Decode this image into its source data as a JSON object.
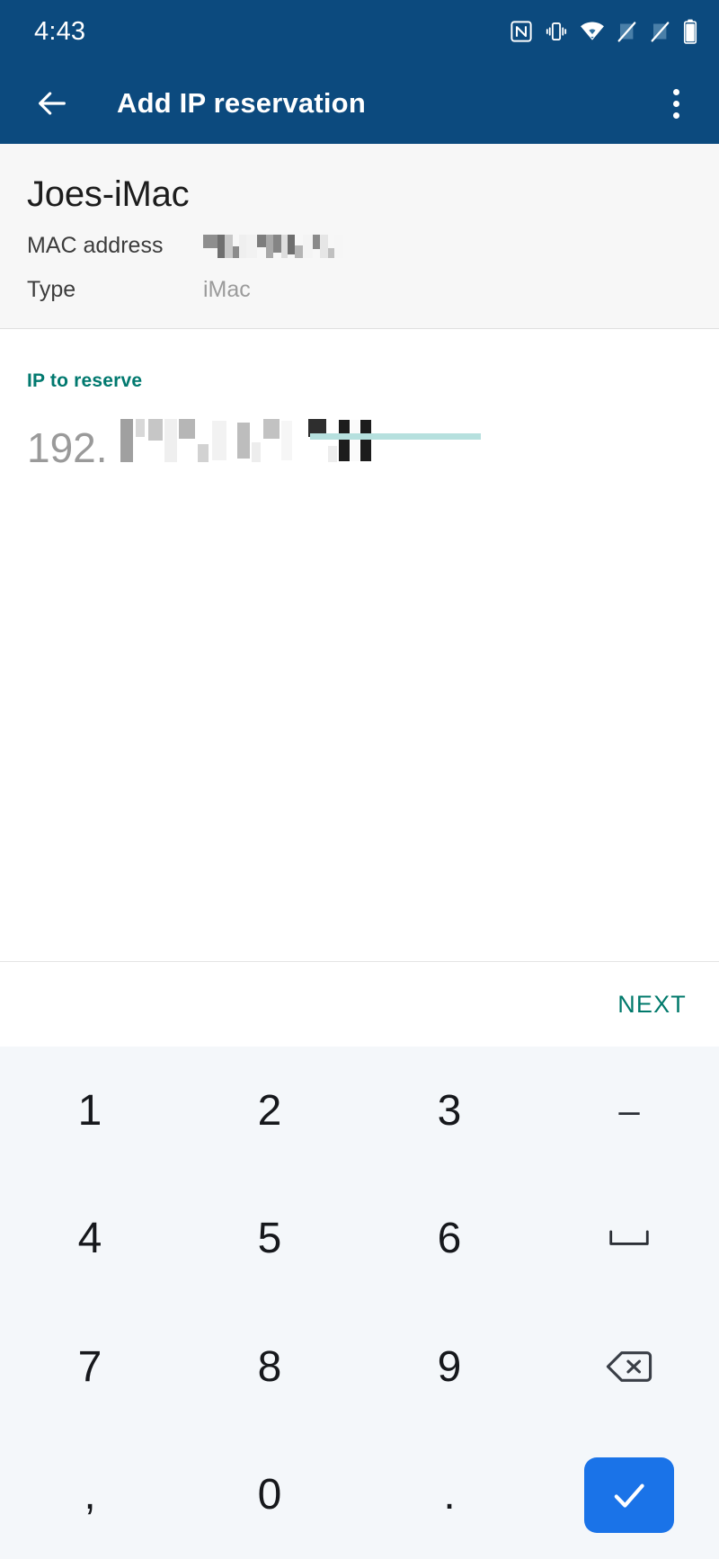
{
  "status_bar": {
    "time": "4:43",
    "icons": [
      "nfc-icon",
      "vibrate-icon",
      "wifi-icon",
      "signal-off-icon",
      "signal-off-icon",
      "battery-icon"
    ]
  },
  "app_bar": {
    "back_label": "back-arrow",
    "title": "Add IP reservation",
    "overflow_label": "more-options"
  },
  "device": {
    "name": "Joes-iMac",
    "mac_label": "MAC address",
    "mac_value": "",
    "type_label": "Type",
    "type_value": "iMac"
  },
  "ip_field": {
    "label": "IP to reserve",
    "prefix": "192.",
    "value": "",
    "placeholder": "192.168.1.100"
  },
  "actions": {
    "next_label": "NEXT"
  },
  "keypad": {
    "rows": [
      [
        {
          "label": "1",
          "name": "key-1"
        },
        {
          "label": "2",
          "name": "key-2"
        },
        {
          "label": "3",
          "name": "key-3"
        },
        {
          "label": "–",
          "name": "key-dash"
        }
      ],
      [
        {
          "label": "4",
          "name": "key-4"
        },
        {
          "label": "5",
          "name": "key-5"
        },
        {
          "label": "6",
          "name": "key-6"
        },
        {
          "label": "␣",
          "name": "key-space"
        }
      ],
      [
        {
          "label": "7",
          "name": "key-7"
        },
        {
          "label": "8",
          "name": "key-8"
        },
        {
          "label": "9",
          "name": "key-9"
        },
        {
          "label": "backspace-icon",
          "name": "key-backspace"
        }
      ],
      [
        {
          "label": ",",
          "name": "key-comma"
        },
        {
          "label": "0",
          "name": "key-0"
        },
        {
          "label": ".",
          "name": "key-period"
        },
        {
          "label": "check-icon",
          "name": "key-enter"
        }
      ]
    ]
  },
  "colors": {
    "app_bar": "#0c4a7e",
    "accent_teal": "#00796b",
    "label_teal": "#01796f",
    "underline": "#b6e0de",
    "enter_blue": "#1a73e8",
    "keypad_bg": "#f4f7fa",
    "card_bg": "#f7f7f7"
  }
}
